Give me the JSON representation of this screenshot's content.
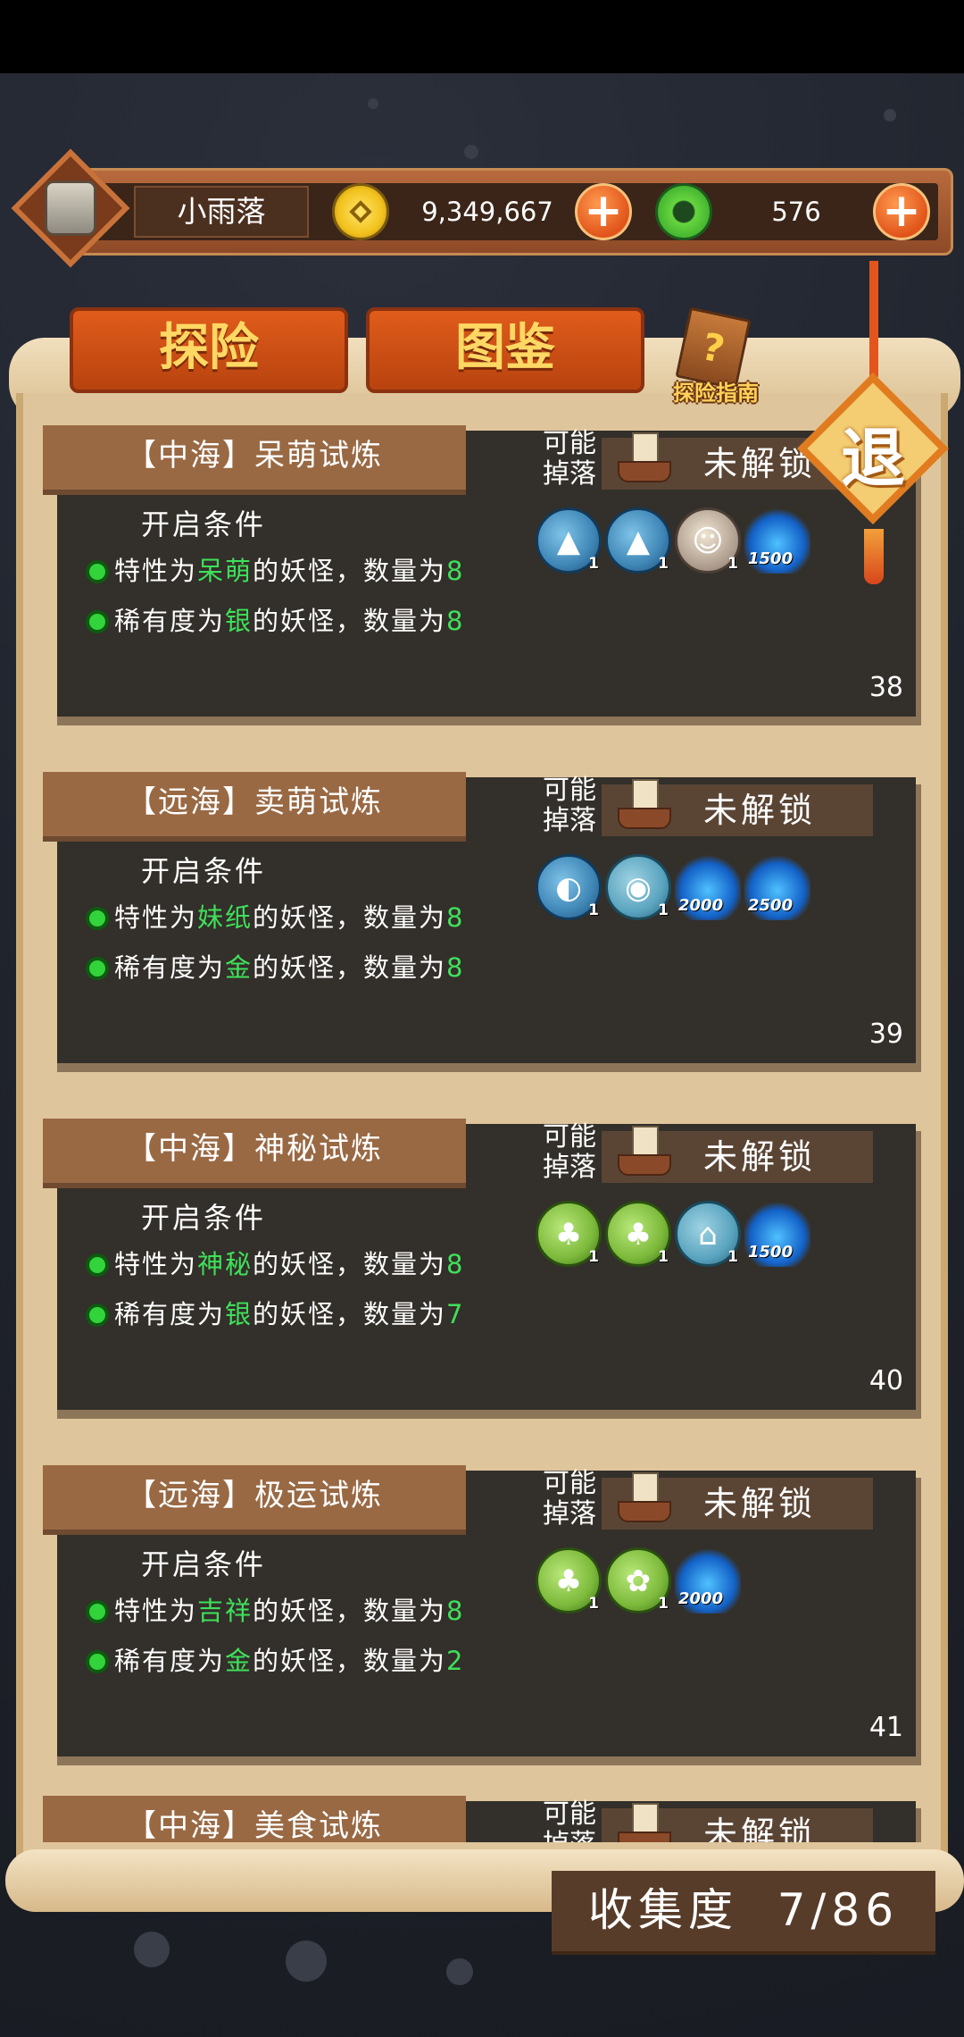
{
  "player": {
    "name": "小雨落"
  },
  "currency": {
    "coins": "9,349,667",
    "jade": "576"
  },
  "tabs": [
    {
      "label": "探险"
    },
    {
      "label": "图鉴"
    }
  ],
  "guide": {
    "label": "探险指南"
  },
  "exit": {
    "label": "退"
  },
  "labels": {
    "drop": "可能掉落",
    "locked": "未解锁",
    "conditions_head": "开启条件"
  },
  "cards": [
    {
      "title": "【中海】呆萌试炼",
      "c1_pre": "特性为",
      "c1_hl": "呆萌",
      "c1_post": "的妖怪，数量为",
      "c1_n": "8",
      "c2_pre": "稀有度为",
      "c2_hl": "银",
      "c2_post": "的妖怪，数量为",
      "c2_n": "8",
      "number": "38",
      "drops": [
        {
          "type": "blue",
          "count": "1"
        },
        {
          "type": "blue",
          "count": "1"
        },
        {
          "type": "doll",
          "count": "1"
        },
        {
          "type": "flame",
          "count": "1500"
        }
      ]
    },
    {
      "title": "【远海】卖萌试炼",
      "c1_pre": "特性为",
      "c1_hl": "妹纸",
      "c1_post": "的妖怪，数量为",
      "c1_n": "8",
      "c2_pre": "稀有度为",
      "c2_hl": "金",
      "c2_post": "的妖怪，数量为",
      "c2_n": "8",
      "number": "39",
      "drops": [
        {
          "type": "blue",
          "count": "1"
        },
        {
          "type": "teal",
          "count": "1"
        },
        {
          "type": "flame",
          "count": "2000"
        },
        {
          "type": "flame",
          "count": "2500"
        }
      ]
    },
    {
      "title": "【中海】神秘试炼",
      "c1_pre": "特性为",
      "c1_hl": "神秘",
      "c1_post": "的妖怪，数量为",
      "c1_n": "8",
      "c2_pre": "稀有度为",
      "c2_hl": "银",
      "c2_post": "的妖怪，数量为",
      "c2_n": "7",
      "number": "40",
      "drops": [
        {
          "type": "greenc",
          "count": "1"
        },
        {
          "type": "greenc",
          "count": "1"
        },
        {
          "type": "teal",
          "count": "1"
        },
        {
          "type": "flame",
          "count": "1500"
        }
      ]
    },
    {
      "title": "【远海】极运试炼",
      "c1_pre": "特性为",
      "c1_hl": "吉祥",
      "c1_post": "的妖怪，数量为",
      "c1_n": "8",
      "c2_pre": "稀有度为",
      "c2_hl": "金",
      "c2_post": "的妖怪，数量为",
      "c2_n": "2",
      "number": "41",
      "drops": [
        {
          "type": "greenc",
          "count": "1"
        },
        {
          "type": "greenc",
          "count": "1"
        },
        {
          "type": "flame",
          "count": "2000"
        }
      ]
    },
    {
      "title": "【中海】美食试炼"
    }
  ],
  "collection": {
    "label": "收集度",
    "value": "7/86"
  }
}
